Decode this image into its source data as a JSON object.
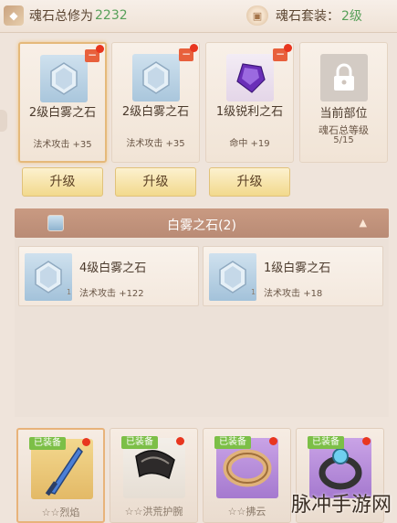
{
  "header": {
    "title": "魂石总修为",
    "value": "2232",
    "set_label": "魂石套装：",
    "set_value": "2级"
  },
  "cards": [
    {
      "name": "2级白雾之石",
      "stat_label": "法术攻击",
      "stat_value": "+35",
      "gem": "white-gem-icon",
      "has_minus": true,
      "has_dot": true,
      "button": "升级"
    },
    {
      "name": "2级白雾之石",
      "stat_label": "法术攻击",
      "stat_value": "+35",
      "gem": "white-gem-icon",
      "has_minus": true,
      "has_dot": true,
      "button": "升级"
    },
    {
      "name": "1级锐利之石",
      "stat_label": "命中",
      "stat_value": "+19",
      "gem": "purple-gem-icon",
      "has_minus": true,
      "has_dot": true,
      "button": "升级"
    },
    {
      "name": "当前部位",
      "sub1": "魂石总等级",
      "sub2": "5/15",
      "gem": "lock-icon"
    }
  ],
  "section": {
    "title": "白雾之石(2)"
  },
  "items": [
    {
      "name": "4级白雾之石",
      "stat_label": "法术攻击",
      "stat_value": "+122",
      "count": "1"
    },
    {
      "name": "1级白雾之石",
      "stat_label": "法术攻击",
      "stat_value": "+18",
      "count": "1"
    }
  ],
  "equipment": [
    {
      "tag": "已装备",
      "name": "☆☆烈焰",
      "icon": "sword-icon"
    },
    {
      "tag": "已装备",
      "name": "☆☆洪荒护腕",
      "icon": "bracer-icon"
    },
    {
      "tag": "已装备",
      "name": "☆☆拂云",
      "icon": "ring-icon"
    },
    {
      "tag": "已装备",
      "name": "",
      "icon": "amulet-ring-icon"
    }
  ],
  "watermark": "脉冲手游网",
  "colors": {
    "accent_green": "#58a05a",
    "red_dot": "#e8361f",
    "button_gold": "#f2d98c",
    "section_bar": "#c29380"
  }
}
